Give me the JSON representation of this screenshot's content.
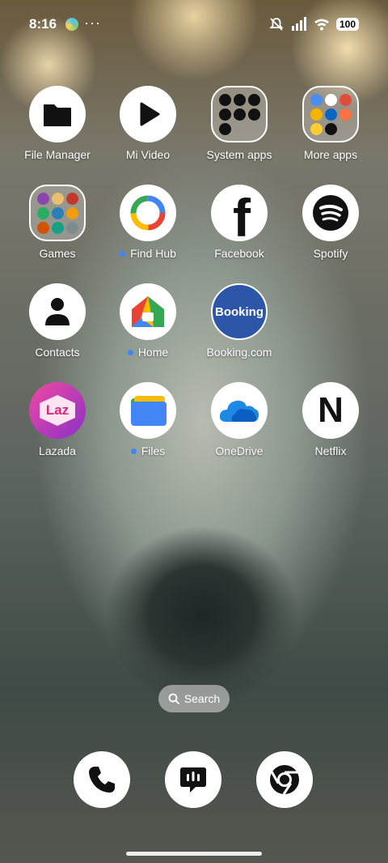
{
  "status_bar": {
    "time": "8:16",
    "overflow_dots": "···",
    "battery": "100"
  },
  "apps": [
    {
      "label": "File Manager"
    },
    {
      "label": "Mi Video"
    },
    {
      "label": "System apps"
    },
    {
      "label": "More apps"
    },
    {
      "label": "Games"
    },
    {
      "label": "Find Hub"
    },
    {
      "label": "Facebook"
    },
    {
      "label": "Spotify"
    },
    {
      "label": "Contacts"
    },
    {
      "label": "Home"
    },
    {
      "label": "Booking.com",
      "icon_text": "Booking"
    },
    {
      "label": "Lazada",
      "icon_text": "Laz"
    },
    {
      "label": "Files"
    },
    {
      "label": "OneDrive"
    },
    {
      "label": "Netflix",
      "icon_text": "N"
    }
  ],
  "search": {
    "label": "Search"
  },
  "colors": {
    "new_dot": "#3d86f5",
    "booking": "#2d55a8"
  }
}
